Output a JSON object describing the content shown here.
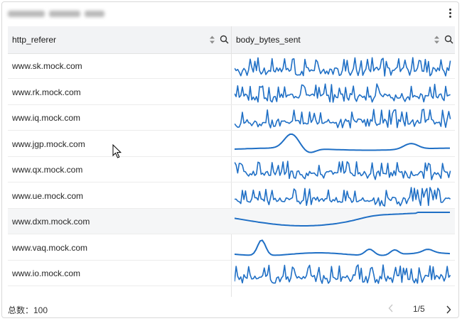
{
  "columns": [
    {
      "label": "http_referer"
    },
    {
      "label": "body_bytes_sent"
    }
  ],
  "rows": [
    {
      "referer": "www.sk.mock.com",
      "spark": "spiky"
    },
    {
      "referer": "www.rk.mock.com",
      "spark": "spiky"
    },
    {
      "referer": "www.iq.mock.com",
      "spark": "spiky"
    },
    {
      "referer": "www.jgp.mock.com",
      "spark": "smooth-peaks"
    },
    {
      "referer": "www.qx.mock.com",
      "spark": "spiky"
    },
    {
      "referer": "www.ue.mock.com",
      "spark": "spiky"
    },
    {
      "referer": "www.dxm.mock.com",
      "spark": "wave",
      "highlighted": true
    },
    {
      "referer": "www.vaq.mock.com",
      "spark": "single-peak"
    },
    {
      "referer": "www.io.mock.com",
      "spark": "spiky"
    },
    {
      "referer": "",
      "spark": "partial"
    }
  ],
  "footer": {
    "total_label": "总数：100",
    "page_label": "1/5"
  },
  "colors": {
    "sparkline": "#1f6fc5",
    "header_bg": "#f2f3f5"
  }
}
